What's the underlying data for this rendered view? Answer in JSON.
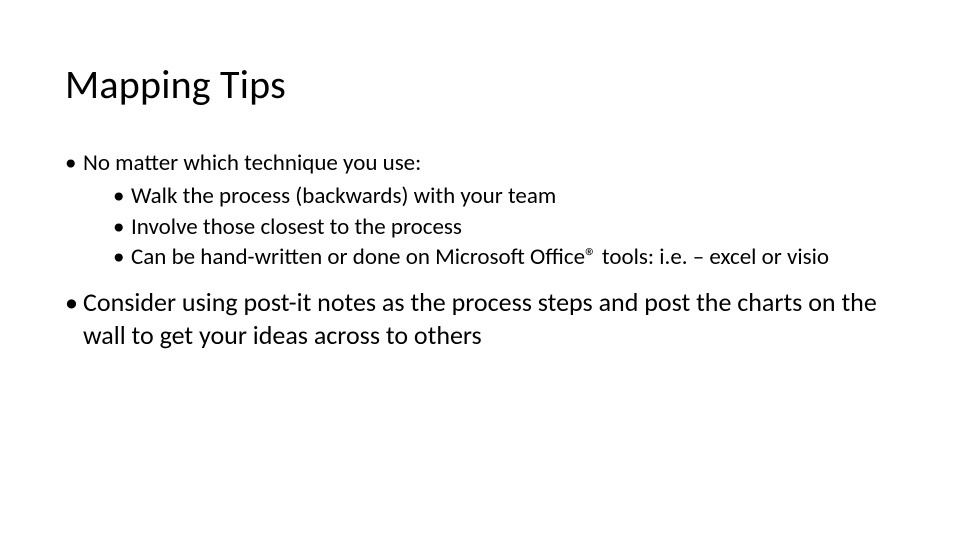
{
  "slide": {
    "title": "Mapping Tips",
    "bullets": {
      "b1": "No matter which technique you use:",
      "b1_sub": {
        "s1": "Walk the process  (backwards) with your team",
        "s2": "Involve those closest to the process",
        "s3": "Can be hand-written or done on Microsoft Office® tools:  i.e. – excel or visio"
      },
      "b2": "Consider using post-it notes as the process steps and post the charts on the wall to get your ideas across to others"
    }
  }
}
